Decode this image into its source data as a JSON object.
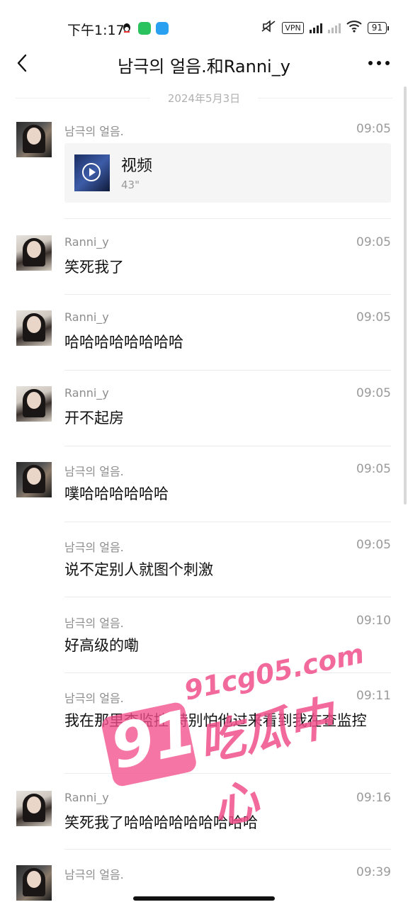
{
  "status": {
    "time": "下午1:17",
    "vpn": "VPN",
    "battery": "91"
  },
  "header": {
    "title": "남극의 얼음.和Ranni_y"
  },
  "date_label": "2024年5月3日",
  "messages": [
    {
      "sender": "남극의 얼음.",
      "time": "09:05",
      "video": {
        "label": "视频",
        "duration": "43\""
      }
    },
    {
      "sender": "Ranni_y",
      "time": "09:05",
      "text": "笑死我了"
    },
    {
      "sender": "Ranni_y",
      "time": "09:05",
      "text": "哈哈哈哈哈哈哈哈"
    },
    {
      "sender": "Ranni_y",
      "time": "09:05",
      "text": "开不起房"
    },
    {
      "sender": "남극의 얼음.",
      "time": "09:05",
      "text": "噗哈哈哈哈哈哈"
    },
    {
      "sender": "남극의 얼음.",
      "time": "09:05",
      "text": "说不定别人就图个刺激"
    },
    {
      "sender": "남극의 얼음.",
      "time": "09:10",
      "text": "好高级的嘞"
    },
    {
      "sender": "남극의 얼음.",
      "time": "09:11",
      "text": "我在那里查监控 特别怕他过来看到我在查监控"
    },
    {
      "sender": "Ranni_y",
      "time": "09:16",
      "text": "笑死我了哈哈哈哈哈哈哈哈哈"
    },
    {
      "sender": "남극의 얼음.",
      "time": "09:39"
    }
  ],
  "watermark": {
    "badge": "91",
    "domain": "91cg05.com",
    "text": "吃瓜中心"
  },
  "colors": {
    "watermark_pink": "#f0508a",
    "muted_text": "#8d8d8d"
  }
}
